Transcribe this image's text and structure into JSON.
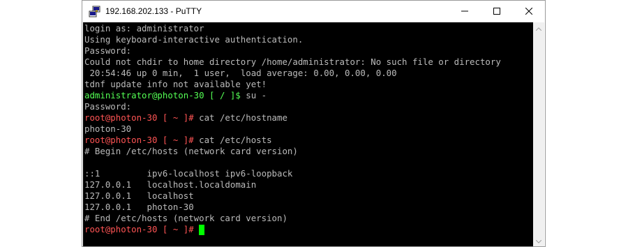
{
  "window": {
    "title": "192.168.202.133 - PuTTY",
    "icons": {
      "app": "putty-icon",
      "minimize": "minimize-icon",
      "maximize": "maximize-icon",
      "close": "close-icon"
    }
  },
  "terminal": {
    "background": "#000000",
    "foreground": "#bbbbbb",
    "user_prompt_color": "#54ff54",
    "root_prompt_color": "#ff5454",
    "lines": [
      {
        "text": "login as: administrator"
      },
      {
        "text": "Using keyboard-interactive authentication."
      },
      {
        "text": "Password:"
      },
      {
        "text": "Could not chdir to home directory /home/administrator: No such file or directory"
      },
      {
        "text": " 20:54:46 up 0 min,  1 user,  load average: 0.00, 0.00, 0.00"
      },
      {
        "text": "tdnf update info not available yet!"
      },
      {
        "prompt": "administrator@photon-30 [ / ]$",
        "command": " su -"
      },
      {
        "text": "Password:"
      },
      {
        "prompt": "root@photon-30 [ ~ ]#",
        "command": " cat /etc/hostname"
      },
      {
        "text": "photon-30"
      },
      {
        "prompt": "root@photon-30 [ ~ ]#",
        "command": " cat /etc/hosts"
      },
      {
        "text": "# Begin /etc/hosts (network card version)"
      },
      {
        "text": ""
      },
      {
        "text": "::1         ipv6-localhost ipv6-loopback"
      },
      {
        "text": "127.0.0.1   localhost.localdomain"
      },
      {
        "text": "127.0.0.1   localhost"
      },
      {
        "text": "127.0.0.1   photon-30"
      },
      {
        "text": "# End /etc/hosts (network card version)"
      },
      {
        "prompt": "root@photon-30 [ ~ ]#",
        "command": " "
      }
    ]
  }
}
